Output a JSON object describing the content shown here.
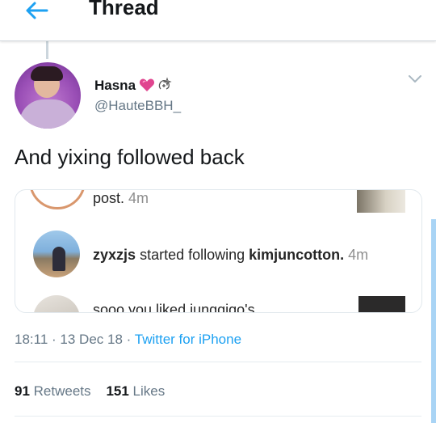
{
  "header": {
    "title": "Thread",
    "back_icon": "arrow-left-icon",
    "accent": "#1da1f2"
  },
  "tweet": {
    "author_name": "Hasna",
    "name_emojis": [
      "pink-heart-icon",
      "sparkle-icon"
    ],
    "handle": "@HauteBBH_",
    "text": "And yixing followed back",
    "menu_icon": "chevron-down-icon"
  },
  "media": {
    "top_row": {
      "text": "post.",
      "time": "4m"
    },
    "follow_row": {
      "user": "zyxzjs",
      "action": "started following",
      "target": "kimjuncotton.",
      "time": "4m"
    },
    "bottom_row": {
      "text": "sooo you liked jungqiqo's"
    }
  },
  "meta": {
    "time": "18:11",
    "sep1": "·",
    "date": "13 Dec 18",
    "sep2": "·",
    "source": "Twitter for iPhone"
  },
  "stats": {
    "retweets_count": "91",
    "retweets_label": "Retweets",
    "likes_count": "151",
    "likes_label": "Likes"
  }
}
